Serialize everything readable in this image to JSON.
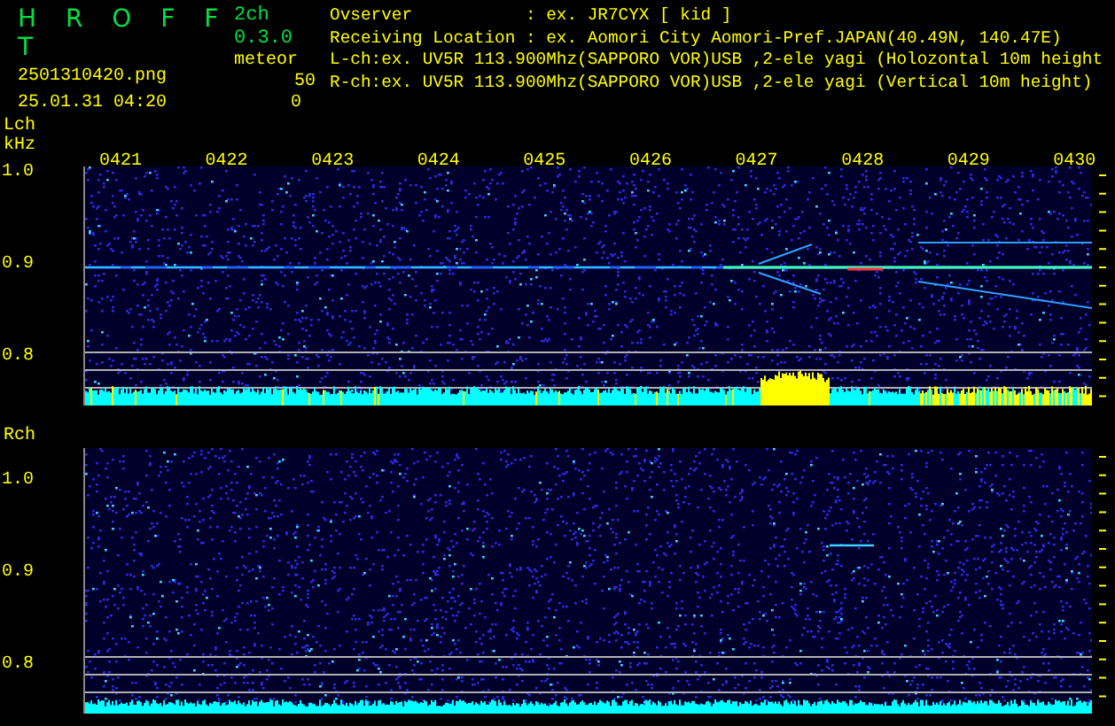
{
  "header": {
    "title": "H R O F F T",
    "filename": "2501310420.png",
    "datetime": "25.01.31 04:20",
    "version": "2ch 0.3.0",
    "mode": "meteor",
    "counts": [
      "50",
      "0"
    ],
    "info_lines": [
      "Ovserver           : ex. JR7CYX [ kid ]",
      "Receiving Location : ex. Aomori City Aomori-Pref.JAPAN(40.49N, 140.47E)",
      "L-ch:ex. UV5R 113.900Mhz(SAPPORO VOR)USB ,2-ele yagi (Holozontal 10m height",
      "R-ch:ex. UV5R 113.900Mhz(SAPPORO VOR)USB ,2-ele yagi (Vertical 10m height)"
    ]
  },
  "channels": [
    {
      "label": "Lch",
      "unit": "kHz",
      "times": [
        "0421",
        "0422",
        "0423",
        "0424",
        "0425",
        "0426",
        "0427",
        "0428",
        "0429",
        "0430"
      ],
      "y_labels": [
        "1.0",
        "0.9",
        "0.8"
      ]
    },
    {
      "label": "Rch",
      "y_labels": [
        "1.0",
        "0.9",
        "0.8"
      ]
    }
  ]
}
